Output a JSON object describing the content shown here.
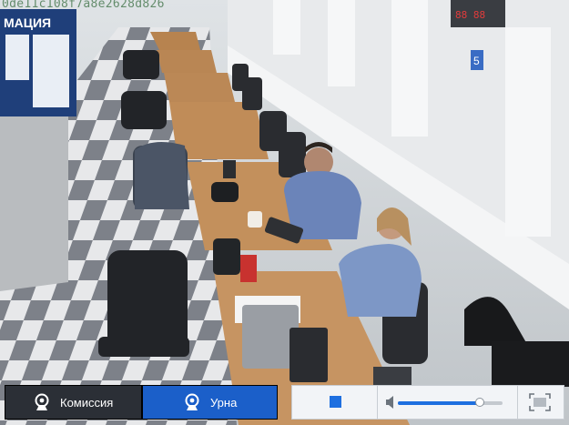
{
  "camera": {
    "id_overlay": "0de11c108f7a8e2628d826",
    "scene_text": {
      "wall_sign": "МАЦИЯ",
      "window_number": "5"
    }
  },
  "toolbar": {
    "cameras": [
      {
        "label": "Комиссия",
        "icon": "webcam-icon",
        "active": false
      },
      {
        "label": "Урна",
        "icon": "webcam-icon",
        "active": true
      }
    ],
    "player": {
      "stop_icon": "stop-icon",
      "volume_icon": "speaker-icon",
      "volume_level": 0.78,
      "fullscreen_icon": "fullscreen-icon"
    }
  },
  "colors": {
    "active_camera_bg": "#1b5fc9",
    "inactive_camera_bg": "#2b2f36",
    "accent": "#1e6fe0",
    "player_bg": "#f2f4f7"
  }
}
